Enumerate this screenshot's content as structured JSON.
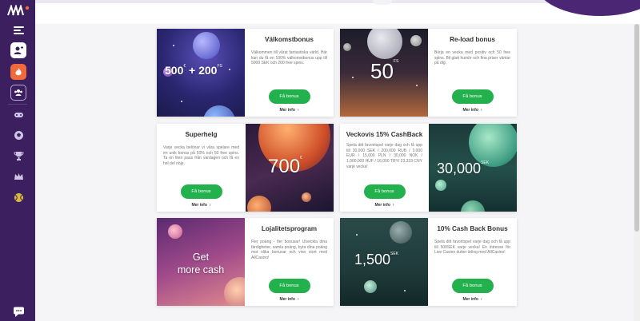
{
  "sidebar": {
    "icons": [
      "menu-icon",
      "add-user-icon",
      "fire-icon",
      "group-icon",
      "gamepad-icon",
      "soccer-ball-icon",
      "trophy-icon",
      "crown-icon",
      "tennis-ball-icon",
      "chat-icon"
    ]
  },
  "cards": [
    {
      "title": "Välkomstbonus",
      "desc": "Välkommen till vårat fantastiska värld. Här kan du få en 100% välkomstbonus upp till 5000 SEK och 200 free spins.",
      "button": "Få bonus",
      "more": "Mer info",
      "amount": "500",
      "amount_sup": "€",
      "amount2": "+ 200",
      "amount2_sup": "FS"
    },
    {
      "title": "Re-load bonus",
      "desc": "Börja en vecka med positiv och 50 free spins. Bli glatt humör och fina priser väntar på dig.",
      "button": "Få bonus",
      "more": "Mer info",
      "amount": "50",
      "amount_sup": "FS"
    },
    {
      "title": "Superhelg",
      "desc": "Varje vecka belönar vi våra spelare med en unik bonus på 50% och 50 free spins. Ta en liten paus från vardagen och få en hel del nöje.",
      "button": "Få bonus",
      "more": "Mer info",
      "amount": "700",
      "amount_sup": "€"
    },
    {
      "title": "Veckovis 15% CashBack",
      "desc": "Spela ditt favoritspel varje dag och få upp till 30,000 SEK / 200,000 RUB / 3,000 EUR / 15,000 PLN / 30,000 NOK / 1,000,000 HUF / 16,000 TRY/ 23,333 CNY varje vecka!",
      "button": "Få bonus",
      "more": "Mer info",
      "amount": "30,000",
      "amount_sup": "SEK"
    },
    {
      "title": "Lojalitetsprogram",
      "desc": "Fler poäng - fler bonusar! Utveckla dina färdigheter, samla poäng, byta dina poäng mot olika bonusar och vinn stort med AllCasino!",
      "button": "Få bonus",
      "more": "Mer info",
      "amount": "Get",
      "amount2": "more cash"
    },
    {
      "title": "10% Cash Back Bonus",
      "desc": "Spela ditt favoritspel varje dag och få upp till 500SEK varje vecka! En intresse för Live Casino dutter ärling med AllCasino!",
      "button": "Få bonus",
      "more": "Mer info",
      "amount": "1,500",
      "amount_sup": "SEK"
    }
  ]
}
